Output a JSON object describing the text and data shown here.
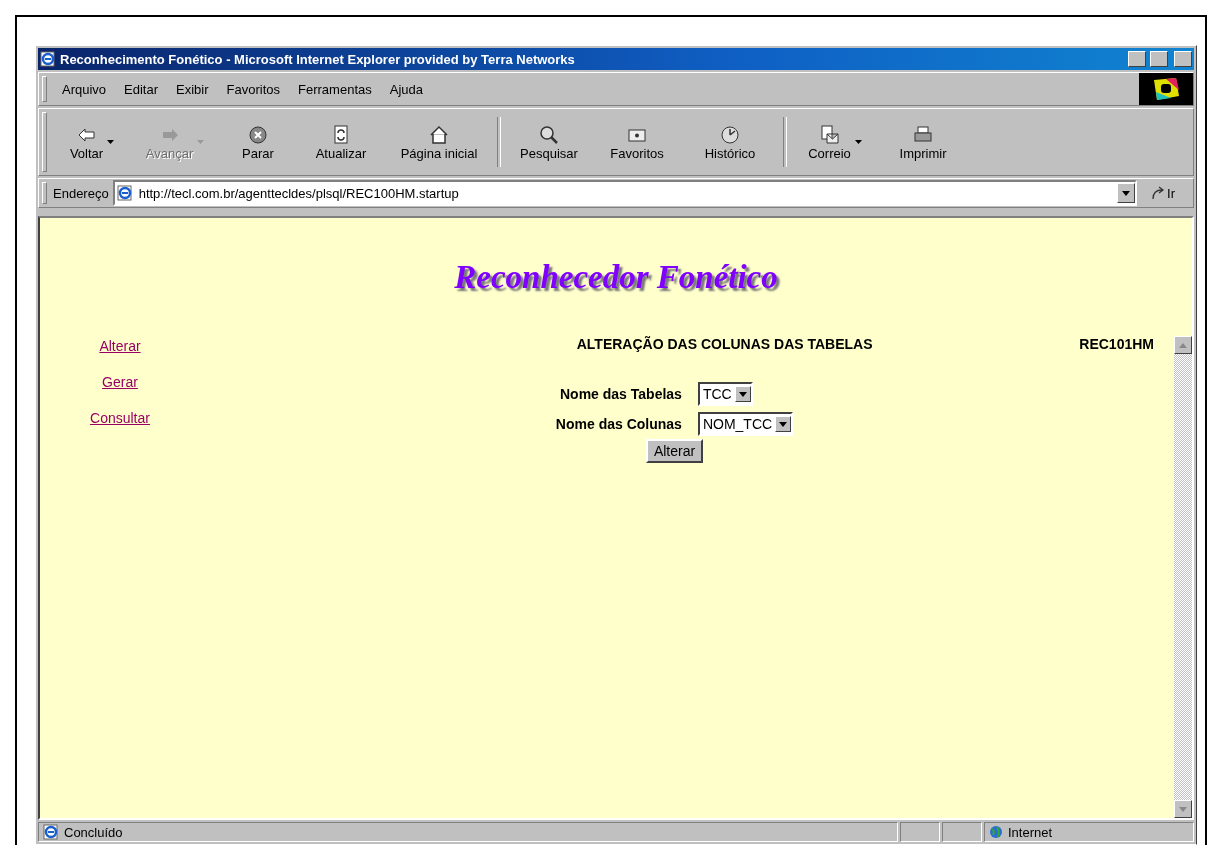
{
  "window": {
    "title": "Reconhecimento Fonético - Microsoft Internet Explorer provided by Terra Networks"
  },
  "menu": [
    {
      "label": "Arquivo"
    },
    {
      "label": "Editar"
    },
    {
      "label": "Exibir"
    },
    {
      "label": "Favoritos"
    },
    {
      "label": "Ferramentas"
    },
    {
      "label": "Ajuda"
    }
  ],
  "toolbar": [
    {
      "label": "Voltar",
      "kind": "back",
      "disabled": false,
      "dropdown": true
    },
    {
      "label": "Avançar",
      "kind": "forward",
      "disabled": true,
      "dropdown": true
    },
    {
      "label": "Parar",
      "kind": "stop",
      "disabled": false,
      "dropdown": false
    },
    {
      "label": "Atualizar",
      "kind": "refresh",
      "disabled": false,
      "dropdown": false
    },
    {
      "label": "Página inicial",
      "kind": "home",
      "disabled": false,
      "dropdown": false
    },
    {
      "label": "Pesquisar",
      "kind": "search",
      "disabled": false,
      "dropdown": false
    },
    {
      "label": "Favoritos",
      "kind": "favorites",
      "disabled": false,
      "dropdown": false
    },
    {
      "label": "Histórico",
      "kind": "history",
      "disabled": false,
      "dropdown": false
    },
    {
      "label": "Correio",
      "kind": "mail",
      "disabled": false,
      "dropdown": true
    },
    {
      "label": "Imprimir",
      "kind": "print",
      "disabled": false,
      "dropdown": false
    }
  ],
  "address": {
    "label": "Endereço",
    "url": "http://tecl.com.br/agenttecldes/plsql/REC100HM.startup",
    "go": "Ir"
  },
  "page": {
    "heading": "Reconhecedor Fonético",
    "nav": [
      "Alterar",
      "Gerar",
      "Consultar"
    ],
    "section_title": "ALTERAÇÃO DAS COLUNAS DAS TABELAS",
    "code": "REC101HM",
    "fields": [
      {
        "label": "Nome das Tabelas",
        "value": "TCC"
      },
      {
        "label": "Nome das Colunas",
        "value": "NOM_TCC"
      }
    ],
    "submit": "Alterar"
  },
  "status_bar": {
    "text": "Concluído",
    "zone": "Internet"
  }
}
